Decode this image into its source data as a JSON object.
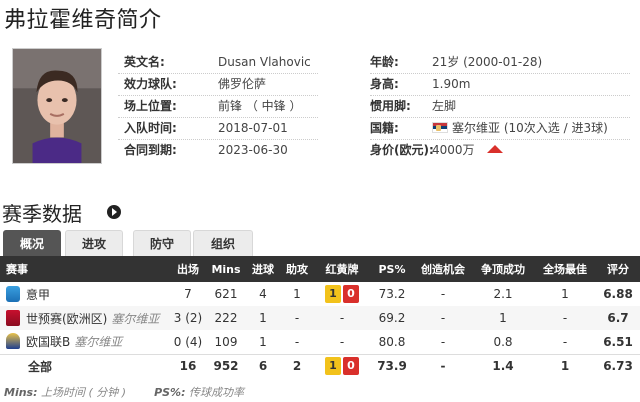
{
  "page_title": "弗拉霍维奇简介",
  "profile": {
    "left": [
      {
        "label": "英文名:",
        "value": "Dusan Vlahovic"
      },
      {
        "label": "效力球队:",
        "value": "佛罗伦萨"
      },
      {
        "label": "场上位置:",
        "value": "前锋 （ 中锋 ）"
      },
      {
        "label": "入队时间:",
        "value": "2018-07-01"
      },
      {
        "label": "合同到期:",
        "value": "2023-06-30"
      }
    ],
    "right": [
      {
        "label": "年龄:",
        "value": "21岁  (2000-01-28)"
      },
      {
        "label": "身高:",
        "value": "1.90m"
      },
      {
        "label": "惯用脚:",
        "value": "左脚"
      },
      {
        "label": "国籍:",
        "value": "塞尔维亚 (10次入选 / 进3球)",
        "flag": "serbia-flag-icon"
      },
      {
        "label": "身价(欧元):",
        "value": "4000万",
        "trend": "up-arrow-icon"
      }
    ]
  },
  "season_title": "赛季数据",
  "tabs": [
    "概况",
    "进攻",
    "防守",
    "组织"
  ],
  "table": {
    "headers": [
      "赛事",
      "出场",
      "Mins",
      "进球",
      "助攻",
      "红黄牌",
      "PS%",
      "创造机会",
      "争顶成功",
      "全场最佳",
      "评分"
    ],
    "rows": [
      {
        "comp": "意甲",
        "team": "",
        "icon": "serie-a-icon",
        "apps": "7",
        "mins": "621",
        "goals": "4",
        "assists": "1",
        "yellow": "1",
        "red": "0",
        "ps": "73.2",
        "chances": "-",
        "aerials": "2.1",
        "motm": "1",
        "rating": "6.88"
      },
      {
        "comp": "世预赛(欧洲区)",
        "team": "塞尔维亚",
        "icon": "wc-qualifier-icon",
        "apps": "3 (2)",
        "mins": "222",
        "goals": "1",
        "assists": "-",
        "yellow": "",
        "red": "",
        "cards_text": "-",
        "ps": "69.2",
        "chances": "-",
        "aerials": "1",
        "motm": "-",
        "rating": "6.7"
      },
      {
        "comp": "欧国联B",
        "team": "塞尔维亚",
        "icon": "nations-league-icon",
        "apps": "0 (4)",
        "mins": "109",
        "goals": "1",
        "assists": "-",
        "yellow": "",
        "red": "",
        "cards_text": "-",
        "ps": "80.8",
        "chances": "-",
        "aerials": "0.8",
        "motm": "-",
        "rating": "6.51"
      },
      {
        "comp": "全部",
        "team": "",
        "icon": "",
        "apps": "16",
        "mins": "952",
        "goals": "6",
        "assists": "2",
        "yellow": "1",
        "red": "0",
        "ps": "73.9",
        "chances": "-",
        "aerials": "1.4",
        "motm": "1",
        "rating": "6.73"
      }
    ]
  },
  "footnote": {
    "mins_key": "Mins:",
    "mins_desc": "上场时间 ( 分钟 )",
    "ps_key": "PS%:",
    "ps_desc": "传球成功率"
  },
  "colors": {
    "header_bg": "#333333",
    "rating": "#e0322a",
    "yellow_card": "#f2c21b",
    "red_card": "#d9302b"
  }
}
